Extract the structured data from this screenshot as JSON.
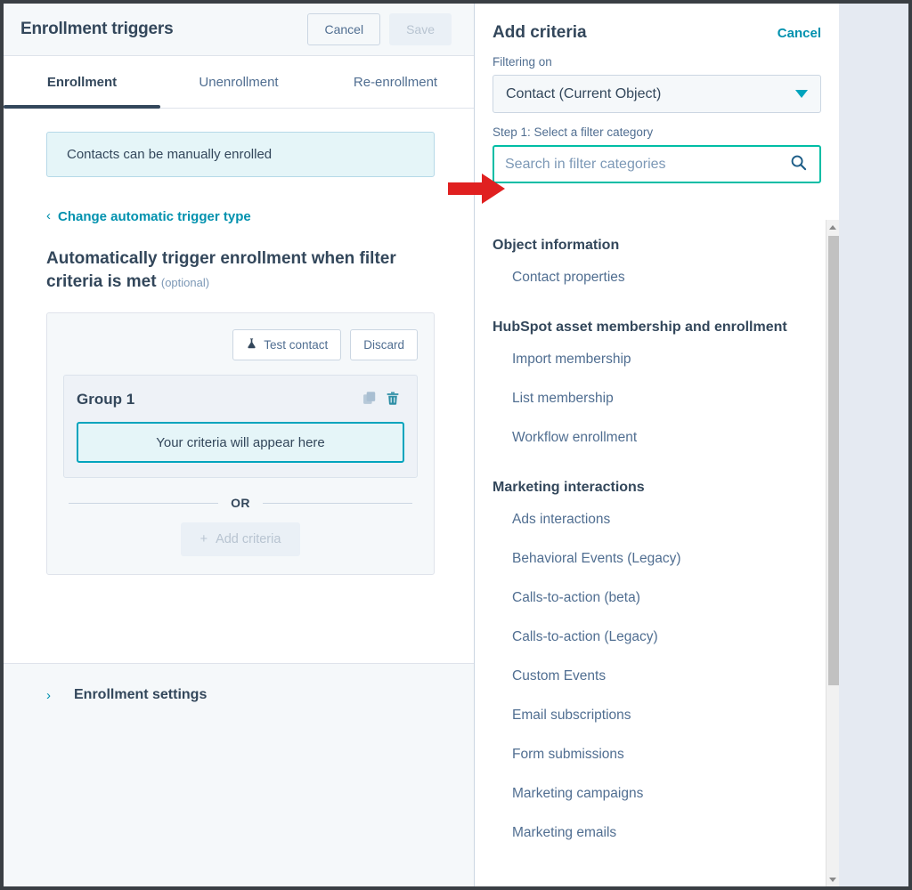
{
  "left_panel": {
    "title": "Enrollment triggers",
    "cancel_label": "Cancel",
    "save_label": "Save",
    "tabs": [
      {
        "label": "Enrollment",
        "active": true
      },
      {
        "label": "Unenrollment",
        "active": false
      },
      {
        "label": "Re-enrollment",
        "active": false
      }
    ],
    "manual_enrollment_notice": "Contacts can be manually enrolled",
    "change_trigger_link": "Change automatic trigger type",
    "chevron_left": "‹",
    "section_heading": "Automatically trigger enrollment when filter criteria is met",
    "section_heading_optional": "(optional)",
    "criteria_card": {
      "test_contact_label": "Test contact",
      "discard_label": "Discard",
      "group_title": "Group 1",
      "criteria_placeholder": "Your criteria will appear here",
      "or_label": "OR",
      "add_criteria_label": "Add criteria",
      "add_criteria_plus": "+"
    },
    "enrollment_settings_label": "Enrollment settings",
    "chevron_right": "›"
  },
  "right_panel": {
    "title": "Add criteria",
    "cancel_label": "Cancel",
    "filtering_on_label": "Filtering on",
    "filtering_on_value": "Contact (Current Object)",
    "step1_label": "Step 1: Select a filter category",
    "search_placeholder": "Search in filter categories",
    "search_value": "",
    "categories": [
      {
        "heading": "Object information",
        "items": [
          "Contact properties"
        ]
      },
      {
        "heading": "HubSpot asset membership and enrollment",
        "items": [
          "Import membership",
          "List membership",
          "Workflow enrollment"
        ]
      },
      {
        "heading": "Marketing interactions",
        "items": [
          "Ads interactions",
          "Behavioral Events (Legacy)",
          "Calls-to-action (beta)",
          "Calls-to-action (Legacy)",
          "Custom Events",
          "Email subscriptions",
          "Form submissions",
          "Marketing campaigns",
          "Marketing emails"
        ]
      }
    ]
  },
  "colors": {
    "brand_teal": "#00a4bd",
    "link_teal": "#0091ae",
    "focus_green": "#00bda5",
    "text_dark": "#33475b",
    "text_muted": "#506e91",
    "panel_bg": "#f5f8fa",
    "notice_bg": "#e5f5f8",
    "annotation_red": "#e02020"
  },
  "annotation": {
    "arrow": "right-arrow-annotation"
  }
}
